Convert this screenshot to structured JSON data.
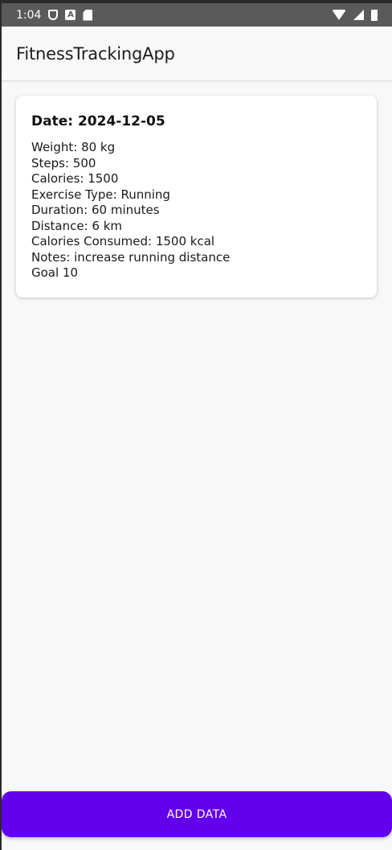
{
  "status_bar": {
    "time": "1:04",
    "icons": [
      "shield-icon",
      "a-icon",
      "sd-card-icon",
      "wifi-icon",
      "signal-icon",
      "battery-icon"
    ]
  },
  "app_bar": {
    "title": "FitnessTrackingApp"
  },
  "entry_card": {
    "date": "Date: 2024-12-05",
    "weight": "Weight: 80 kg",
    "steps": "Steps: 500",
    "calories": "Calories: 1500",
    "exercise_type": "Exercise Type: Running",
    "duration": "Duration: 60 minutes",
    "distance": "Distance: 6 km",
    "calories_consumed": "Calories Consumed: 1500 kcal",
    "notes": "Notes: increase running distance",
    "goal": "Goal 10"
  },
  "actions": {
    "add_data_label": "ADD DATA"
  },
  "colors": {
    "accent": "#6200ee",
    "status_bar": "#5a5a5a",
    "background": "#f8f8f8"
  }
}
